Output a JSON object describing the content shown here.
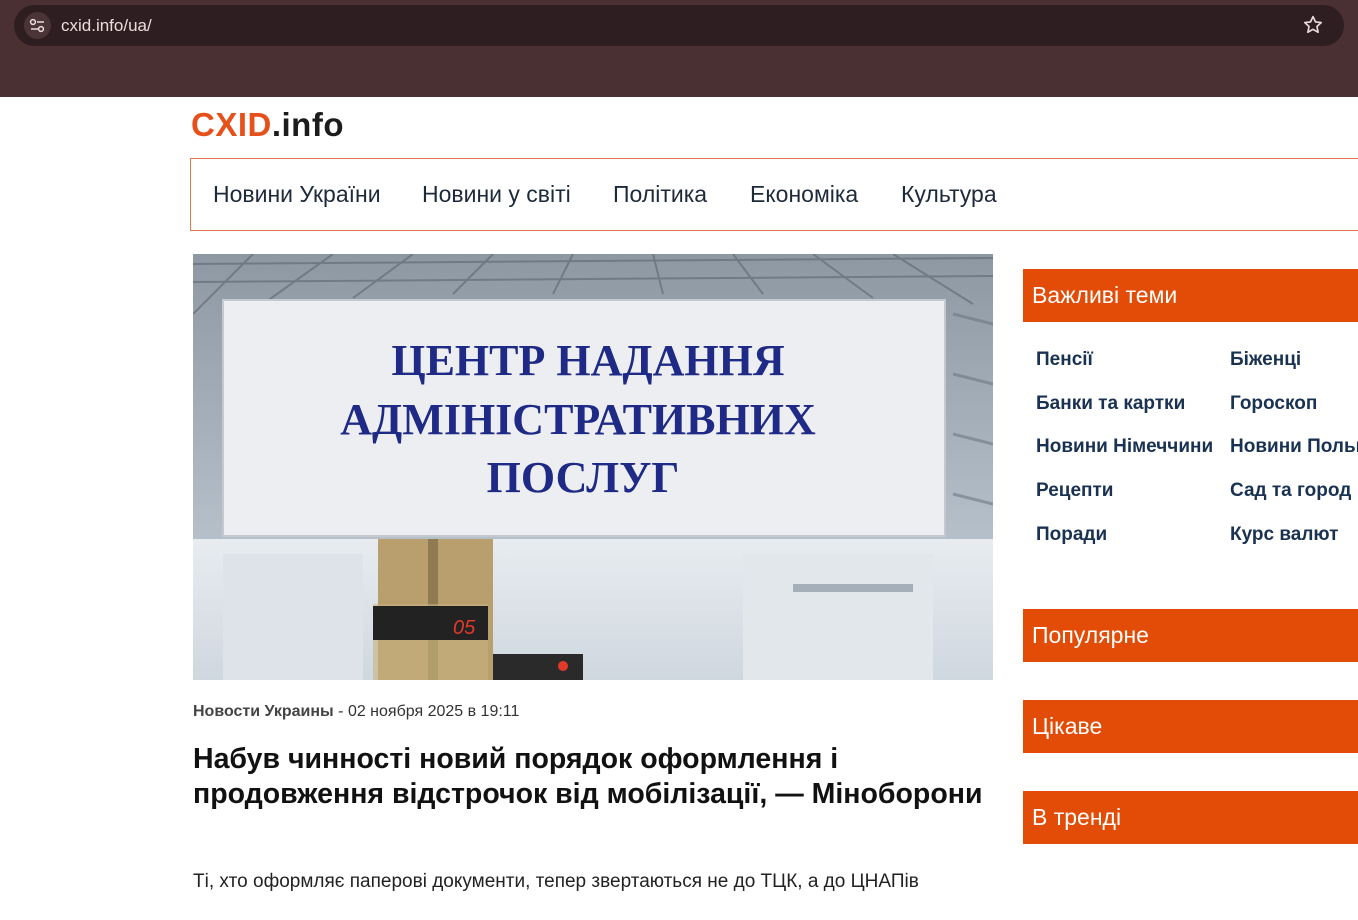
{
  "browser": {
    "url": "cxid.info/ua/"
  },
  "logo": {
    "part1": "CXID",
    "part2": ".info"
  },
  "nav": {
    "items": [
      "Новини України",
      "Новини у світі",
      "Політика",
      "Економіка",
      "Культура"
    ]
  },
  "hero": {
    "sign_lines": [
      "ЦЕНТР НАДАННЯ",
      "АДМІНІСТРАТИВНИХ",
      "ПОСЛУГ"
    ],
    "display_number": "05"
  },
  "article": {
    "category": "Новости Украины",
    "date": " - 02 ноября 2025 в 19:11",
    "title": "Набув чинності новий порядок оформлення і продовження відстрочок від мобілізації, — Міноборони",
    "lead": "Ті, хто оформляє паперові документи, тепер звертаються не до ТЦК, а до ЦНАПів"
  },
  "sidebar": {
    "important_title": "Важливі теми",
    "topics_left": [
      "Пенсії",
      "Банки та картки",
      "Новини Німеччини",
      "Рецепти",
      "Поради"
    ],
    "topics_right": [
      "Біженці",
      "Гороскоп",
      "Новини Польщі",
      "Сад та город",
      "Курс валют"
    ],
    "popular_title": "Популярне",
    "interesting_title": "Цікаве",
    "trending_title": "В тренді"
  },
  "colors": {
    "accent": "#e24c06",
    "chrome": "#4a3033"
  }
}
